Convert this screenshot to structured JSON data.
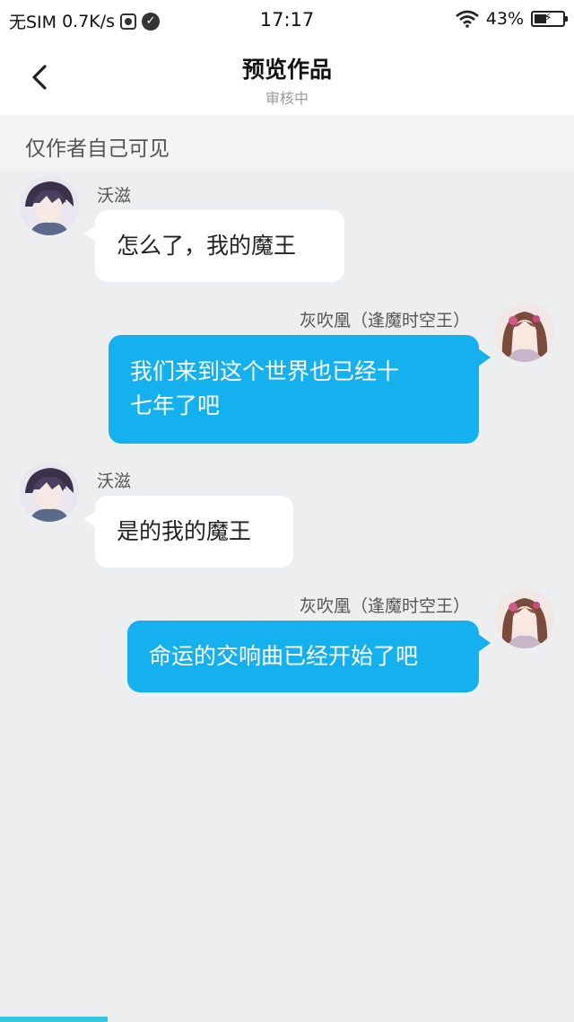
{
  "status_bar": {
    "carrier": "无SIM",
    "speed": "0.7K/s",
    "time": "17:17",
    "battery": "43%",
    "battery_level": 0.43,
    "icons": [
      "app-notification-icon",
      "check-circle-icon",
      "wifi-icon",
      "battery-charging-icon"
    ]
  },
  "header": {
    "back_icon": "chevron-left-icon",
    "title": "预览作品",
    "subtitle": "审核中"
  },
  "notice": "仅作者自己可见",
  "messages": [
    {
      "side": "left",
      "sender": "沃滋",
      "lines": [
        "怎么了，我的魔王"
      ]
    },
    {
      "side": "right",
      "sender": "灰吹凰（逢魔时空王）",
      "lines": [
        "我们来到这个世界也已经十",
        "七年了吧"
      ]
    },
    {
      "side": "left",
      "sender": "沃滋",
      "lines": [
        "是的我的魔王"
      ]
    },
    {
      "side": "right",
      "sender": "灰吹凰（逢魔时空王）",
      "lines": [
        "命运的交响曲已经开始了吧"
      ]
    }
  ],
  "colors": {
    "left_bubble": "#ffffff",
    "right_bubble": "#15b0ee",
    "background": "#eceef0",
    "accent": "#34c7e0"
  }
}
